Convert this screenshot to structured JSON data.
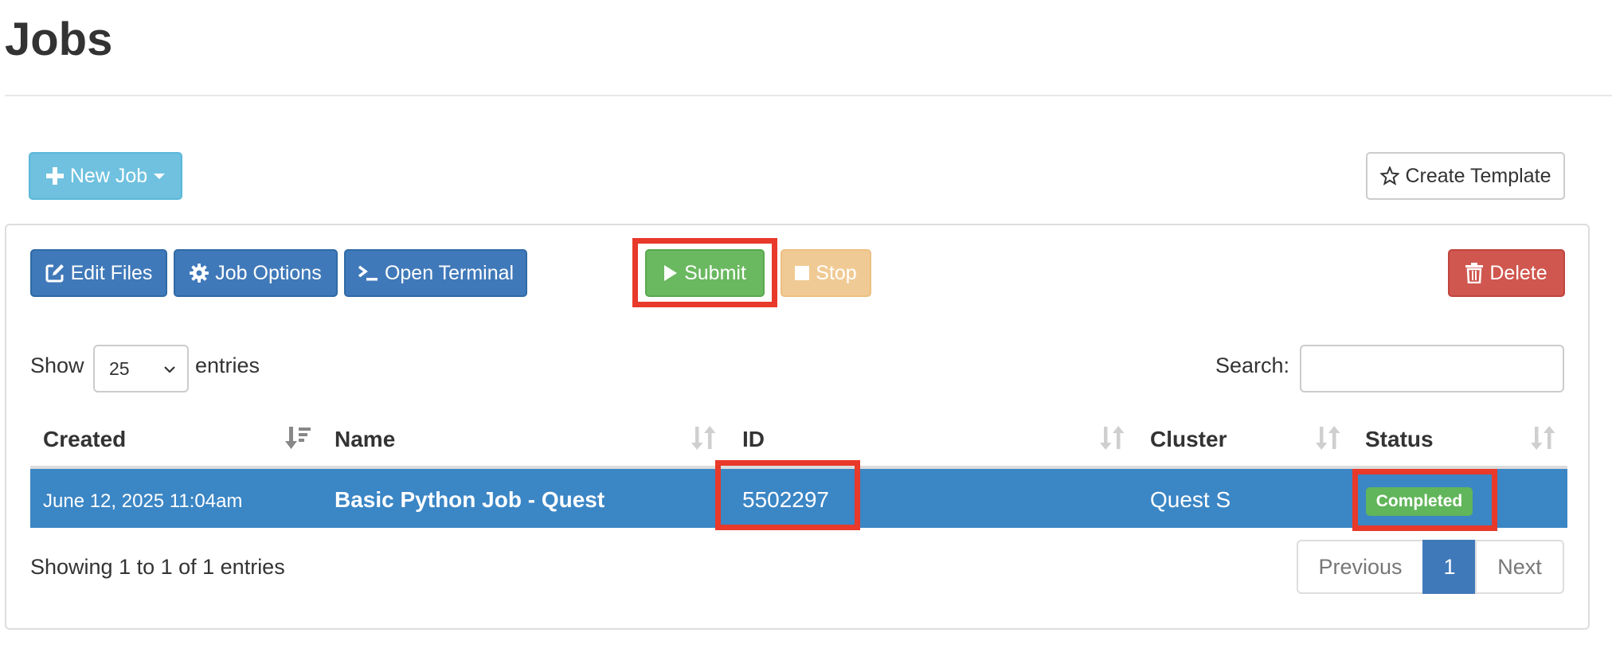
{
  "page": {
    "title": "Jobs"
  },
  "toolbar_top": {
    "new_job_label": "New Job",
    "create_template_label": "Create Template"
  },
  "actions": {
    "edit_files": "Edit Files",
    "job_options": "Job Options",
    "open_terminal": "Open Terminal",
    "submit": "Submit",
    "stop": "Stop",
    "delete": "Delete"
  },
  "table_controls": {
    "show_label": "Show",
    "entries_label": "entries",
    "page_size": "25",
    "search_label": "Search:",
    "search_value": ""
  },
  "table": {
    "columns": [
      "Created",
      "Name",
      "ID",
      "Cluster",
      "Status"
    ],
    "rows": [
      {
        "created": "June 12, 2025 11:04am",
        "name": "Basic Python Job - Quest",
        "id": "5502297",
        "cluster": "Quest S",
        "status": "Completed"
      }
    ]
  },
  "footer": {
    "info": "Showing 1 to 1 of 1 entries",
    "previous": "Previous",
    "current_page": "1",
    "next": "Next"
  },
  "colors": {
    "primary": "#4079b9",
    "success": "#6ab85f",
    "danger": "#d0574f",
    "info": "#6fc1df",
    "selected_row": "#3b86c5",
    "highlight": "#e8392a"
  }
}
